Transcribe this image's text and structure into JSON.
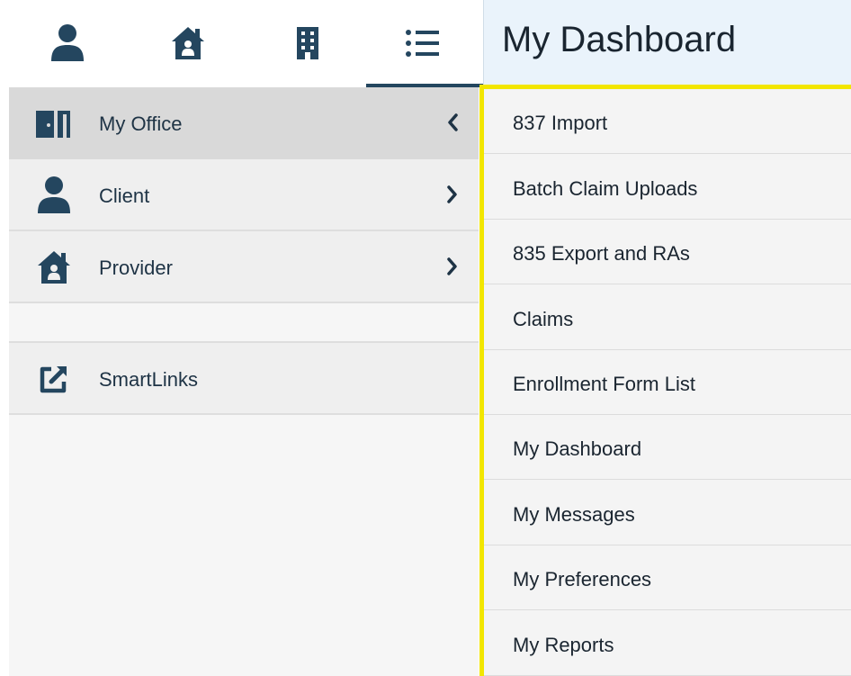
{
  "header": {
    "title": "My Dashboard",
    "tabs": [
      {
        "icon": "person-icon"
      },
      {
        "icon": "house-icon"
      },
      {
        "icon": "building-icon"
      },
      {
        "icon": "list-icon",
        "active": true
      }
    ]
  },
  "sidebar": {
    "items": [
      {
        "label": "My Office",
        "icon": "office-door-icon",
        "chevron": "chevron-left-icon",
        "active": true
      },
      {
        "label": "Client",
        "icon": "person-icon",
        "chevron": "chevron-right-icon"
      },
      {
        "label": "Provider",
        "icon": "house-icon",
        "chevron": "chevron-right-icon"
      },
      {
        "label": "SmartLinks",
        "icon": "external-link-icon"
      }
    ]
  },
  "menu": {
    "items": [
      {
        "label": "837 Import"
      },
      {
        "label": "Batch Claim Uploads"
      },
      {
        "label": "835 Export and RAs"
      },
      {
        "label": "Claims"
      },
      {
        "label": "Enrollment Form List"
      },
      {
        "label": "My Dashboard"
      },
      {
        "label": "My Messages"
      },
      {
        "label": "My Preferences"
      },
      {
        "label": "My Reports"
      }
    ]
  },
  "colors": {
    "icon": "#24465f",
    "highlight_border": "#f2e600",
    "title_bg": "#eaf3fb"
  }
}
